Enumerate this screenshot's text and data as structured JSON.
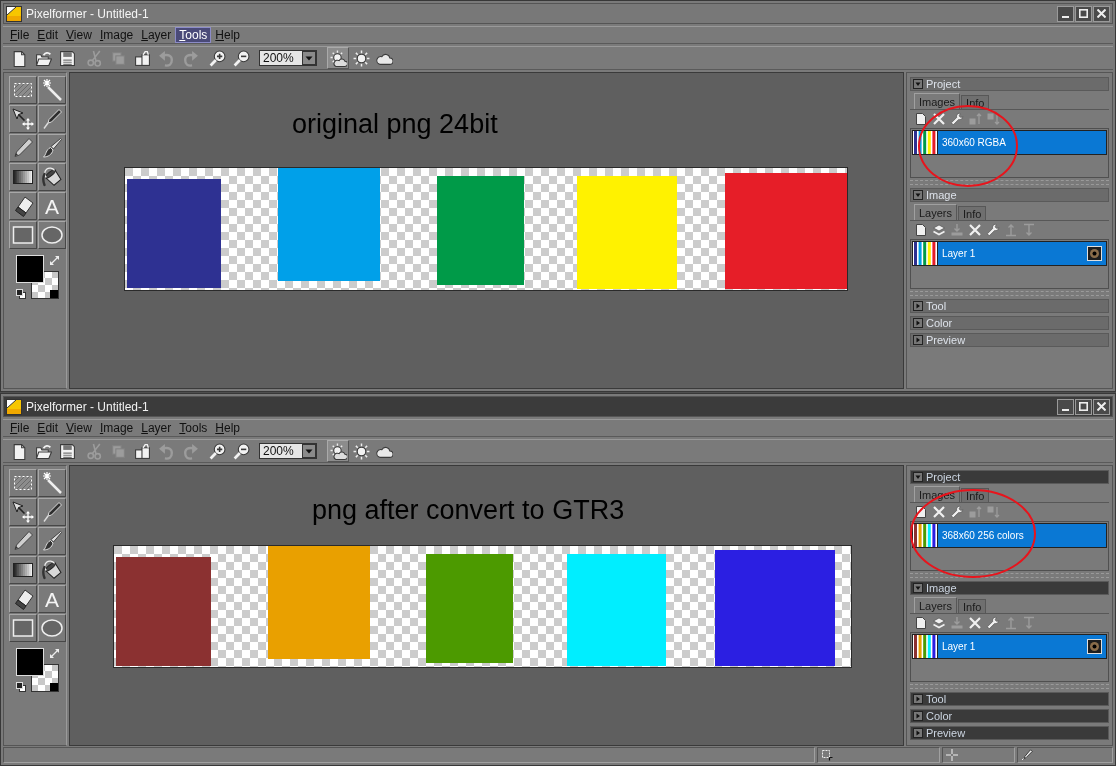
{
  "windows": [
    {
      "title": "Pixelformer - Untitled-1",
      "active": false,
      "menu": [
        {
          "label": "File",
          "selected": false
        },
        {
          "label": "Edit",
          "selected": false
        },
        {
          "label": "View",
          "selected": false
        },
        {
          "label": "Image",
          "selected": false
        },
        {
          "label": "Layer",
          "selected": false
        },
        {
          "label": "Tools",
          "selected": true
        },
        {
          "label": "Help",
          "selected": false
        }
      ],
      "toolbar": {
        "buttons": [
          {
            "kind": "new",
            "disabled": false
          },
          {
            "kind": "open",
            "disabled": false
          },
          {
            "kind": "save",
            "disabled": false
          },
          {
            "kind": "cut",
            "disabled": true
          },
          {
            "kind": "copy",
            "disabled": true
          },
          {
            "kind": "paste",
            "disabled": false
          },
          {
            "kind": "undo",
            "disabled": true
          },
          {
            "kind": "redo",
            "disabled": true
          },
          {
            "kind": "zoom-in",
            "disabled": false
          },
          {
            "kind": "zoom-out",
            "disabled": false
          }
        ],
        "zoom": "200%",
        "view_modes": [
          {
            "kind": "sun-cloud",
            "selected": true
          },
          {
            "kind": "sun",
            "selected": false
          },
          {
            "kind": "cloud",
            "selected": false
          }
        ]
      },
      "tools": [
        {
          "kind": "marquee"
        },
        {
          "kind": "wand"
        },
        {
          "kind": "move"
        },
        {
          "kind": "pen"
        },
        {
          "kind": "pencil"
        },
        {
          "kind": "brush"
        },
        {
          "kind": "gradient"
        },
        {
          "kind": "fill"
        },
        {
          "kind": "eraser"
        },
        {
          "kind": "text",
          "glyph": "A"
        },
        {
          "kind": "rectangle"
        },
        {
          "kind": "ellipse"
        }
      ],
      "color_slots": [
        {
          "kind": "solid",
          "color": "#000000"
        },
        {
          "kind": "transparent"
        }
      ],
      "canvas": {
        "caption": "original png 24bit",
        "swatches": [
          {
            "color": "#2e3192"
          },
          {
            "color": "#00a0e9"
          },
          {
            "color": "#009a48"
          },
          {
            "color": "#fff200"
          },
          {
            "color": "#e61e28"
          }
        ]
      },
      "panels": [
        {
          "title": "Project",
          "expanded": true,
          "circled": true,
          "tabs": [
            {
              "label": "Images",
              "selected": true
            },
            {
              "label": "Info",
              "selected": false
            }
          ],
          "actions": [
            {
              "kind": "new",
              "disabled": false
            },
            {
              "kind": "delete",
              "disabled": false
            },
            {
              "kind": "properties",
              "disabled": false
            },
            {
              "kind": "move-up",
              "disabled": true
            },
            {
              "kind": "move-down",
              "disabled": true
            }
          ],
          "items": [
            {
              "label": "360x60 RGBA",
              "selected": true
            }
          ]
        },
        {
          "title": "Image",
          "expanded": true,
          "circled": false,
          "tabs": [
            {
              "label": "Layers",
              "selected": true
            },
            {
              "label": "Info",
              "selected": false
            }
          ],
          "actions": [
            {
              "kind": "new",
              "disabled": false
            },
            {
              "kind": "stack",
              "disabled": false
            },
            {
              "kind": "merge",
              "disabled": true
            },
            {
              "kind": "delete",
              "disabled": false
            },
            {
              "kind": "properties",
              "disabled": false
            },
            {
              "kind": "raise",
              "disabled": true
            },
            {
              "kind": "lower",
              "disabled": true
            }
          ],
          "items": [
            {
              "label": "Layer 1",
              "selected": true,
              "visible": true
            }
          ]
        },
        {
          "title": "Tool",
          "expanded": false,
          "circled": false
        },
        {
          "title": "Color",
          "expanded": false,
          "circled": false
        },
        {
          "title": "Preview",
          "expanded": false,
          "circled": false
        }
      ]
    },
    {
      "title": "Pixelformer - Untitled-1",
      "active": true,
      "menu": [
        {
          "label": "File",
          "selected": false
        },
        {
          "label": "Edit",
          "selected": false
        },
        {
          "label": "View",
          "selected": false
        },
        {
          "label": "Image",
          "selected": false
        },
        {
          "label": "Layer",
          "selected": false
        },
        {
          "label": "Tools",
          "selected": false
        },
        {
          "label": "Help",
          "selected": false
        }
      ],
      "toolbar": {
        "buttons": [
          {
            "kind": "new",
            "disabled": false
          },
          {
            "kind": "open",
            "disabled": false
          },
          {
            "kind": "save",
            "disabled": false
          },
          {
            "kind": "cut",
            "disabled": true
          },
          {
            "kind": "copy",
            "disabled": true
          },
          {
            "kind": "paste",
            "disabled": false
          },
          {
            "kind": "undo",
            "disabled": true
          },
          {
            "kind": "redo",
            "disabled": true
          },
          {
            "kind": "zoom-in",
            "disabled": false
          },
          {
            "kind": "zoom-out",
            "disabled": false
          }
        ],
        "zoom": "200%",
        "view_modes": [
          {
            "kind": "sun-cloud",
            "selected": true
          },
          {
            "kind": "sun",
            "selected": false
          },
          {
            "kind": "cloud",
            "selected": false
          }
        ]
      },
      "tools": [
        {
          "kind": "marquee"
        },
        {
          "kind": "wand"
        },
        {
          "kind": "move"
        },
        {
          "kind": "pen"
        },
        {
          "kind": "pencil"
        },
        {
          "kind": "brush"
        },
        {
          "kind": "gradient"
        },
        {
          "kind": "fill"
        },
        {
          "kind": "eraser"
        },
        {
          "kind": "text",
          "glyph": "A"
        },
        {
          "kind": "rectangle"
        },
        {
          "kind": "ellipse"
        }
      ],
      "color_slots": [
        {
          "kind": "solid",
          "color": "#000000"
        },
        {
          "kind": "transparent"
        }
      ],
      "canvas": {
        "caption": "png after convert to GTR3",
        "swatches": [
          {
            "color": "#8b3131"
          },
          {
            "color": "#e9a000"
          },
          {
            "color": "#4c9a00"
          },
          {
            "color": "#00eeff"
          },
          {
            "color": "#2b1fe2"
          }
        ]
      },
      "panels": [
        {
          "title": "Project",
          "expanded": true,
          "circled": true,
          "tabs": [
            {
              "label": "Images",
              "selected": true
            },
            {
              "label": "Info",
              "selected": false
            }
          ],
          "actions": [
            {
              "kind": "new",
              "disabled": false
            },
            {
              "kind": "delete",
              "disabled": false
            },
            {
              "kind": "properties",
              "disabled": false
            },
            {
              "kind": "move-up",
              "disabled": true
            },
            {
              "kind": "move-down",
              "disabled": true
            }
          ],
          "items": [
            {
              "label": "368x60 256 colors",
              "selected": true
            }
          ]
        },
        {
          "title": "Image",
          "expanded": true,
          "circled": false,
          "tabs": [
            {
              "label": "Layers",
              "selected": true
            },
            {
              "label": "Info",
              "selected": false
            }
          ],
          "actions": [
            {
              "kind": "new",
              "disabled": false
            },
            {
              "kind": "stack",
              "disabled": false
            },
            {
              "kind": "merge",
              "disabled": true
            },
            {
              "kind": "delete",
              "disabled": false
            },
            {
              "kind": "properties",
              "disabled": false
            },
            {
              "kind": "raise",
              "disabled": true
            },
            {
              "kind": "lower",
              "disabled": true
            }
          ],
          "items": [
            {
              "label": "Layer 1",
              "selected": true,
              "visible": true
            }
          ]
        },
        {
          "title": "Tool",
          "expanded": false,
          "circled": false
        },
        {
          "title": "Color",
          "expanded": false,
          "circled": false
        },
        {
          "title": "Preview",
          "expanded": false,
          "circled": false
        }
      ],
      "status_bar": {
        "fields": [
          {
            "kind": "message"
          },
          {
            "kind": "selection"
          },
          {
            "kind": "position"
          },
          {
            "kind": "color"
          }
        ]
      }
    }
  ]
}
